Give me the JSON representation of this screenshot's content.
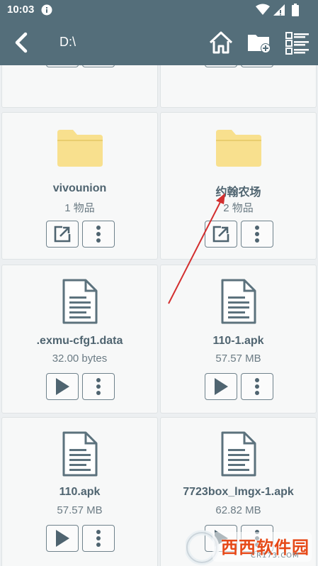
{
  "status": {
    "time": "10:03"
  },
  "toolbar": {
    "path": "D:\\"
  },
  "icons": {
    "back": "back-arrow-icon",
    "home": "home-icon",
    "new_folder": "folder-add-icon",
    "view": "list-view-icon",
    "open_external": "open-external-icon",
    "more": "more-vertical-icon",
    "play": "play-icon",
    "folder": "folder-icon",
    "file": "document-icon"
  },
  "colors": {
    "toolbar": "#546e7a",
    "folder": "#f8e08e",
    "accent": "#4f6470",
    "annotation": "#d32f2f"
  },
  "items": [
    {
      "name": "vivounion",
      "meta": "1 物品",
      "type": "folder"
    },
    {
      "name": "约翰农场",
      "meta": "2 物品",
      "type": "folder"
    },
    {
      "name": ".exmu-cfg1.data",
      "meta": "32.00 bytes",
      "type": "file"
    },
    {
      "name": "110-1.apk",
      "meta": "57.57 MB",
      "type": "file"
    },
    {
      "name": "110.apk",
      "meta": "57.57 MB",
      "type": "file"
    },
    {
      "name": "7723box_lmgx-1.apk",
      "meta": "62.82 MB",
      "type": "file"
    }
  ],
  "watermark": {
    "brand": "西西软件园",
    "site": "CR173.COM"
  }
}
